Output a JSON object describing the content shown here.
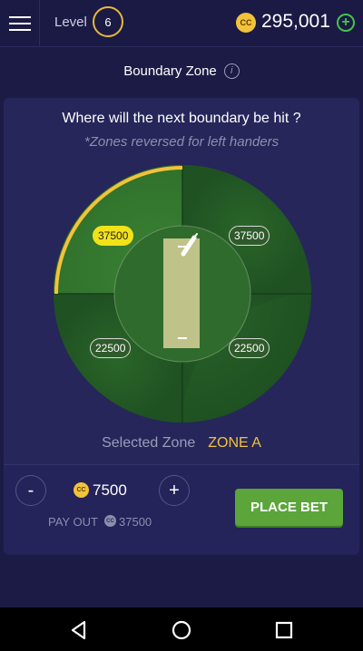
{
  "topbar": {
    "level_label": "Level",
    "level": "6",
    "coin_symbol": "CC",
    "balance": "295,001",
    "add_symbol": "+"
  },
  "header": {
    "title": "Boundary Zone",
    "info_symbol": "i"
  },
  "prompt": {
    "question": "Where will the next boundary be hit ?",
    "note": "*Zones reversed for left handers"
  },
  "zones": [
    {
      "id": "top-left",
      "value": "37500",
      "selected": true
    },
    {
      "id": "top-right",
      "value": "37500",
      "selected": false
    },
    {
      "id": "bottom-left",
      "value": "22500",
      "selected": false
    },
    {
      "id": "bottom-right",
      "value": "22500",
      "selected": false
    }
  ],
  "selection": {
    "label": "Selected Zone",
    "value": "ZONE A"
  },
  "bet": {
    "minus_label": "-",
    "plus_label": "+",
    "coin_symbol": "CC",
    "amount": "7500",
    "payout_label": "PAY OUT",
    "payout_value": "37500",
    "place_bet_label": "PLACE BET"
  },
  "colors": {
    "background": "#1c1b45",
    "card": "#26265a",
    "field_dark": "#245a25",
    "field_light": "#377b30",
    "highlight": "#f2c23a",
    "selected_label": "#f2e218",
    "button_green": "#5ba53a"
  },
  "icons": {
    "menu": "hamburger-icon",
    "info": "info-icon",
    "add": "plus-circle-icon",
    "back": "nav-back-icon",
    "home": "nav-home-icon",
    "recents": "nav-recents-icon",
    "bat": "cricket-bat-icon"
  }
}
